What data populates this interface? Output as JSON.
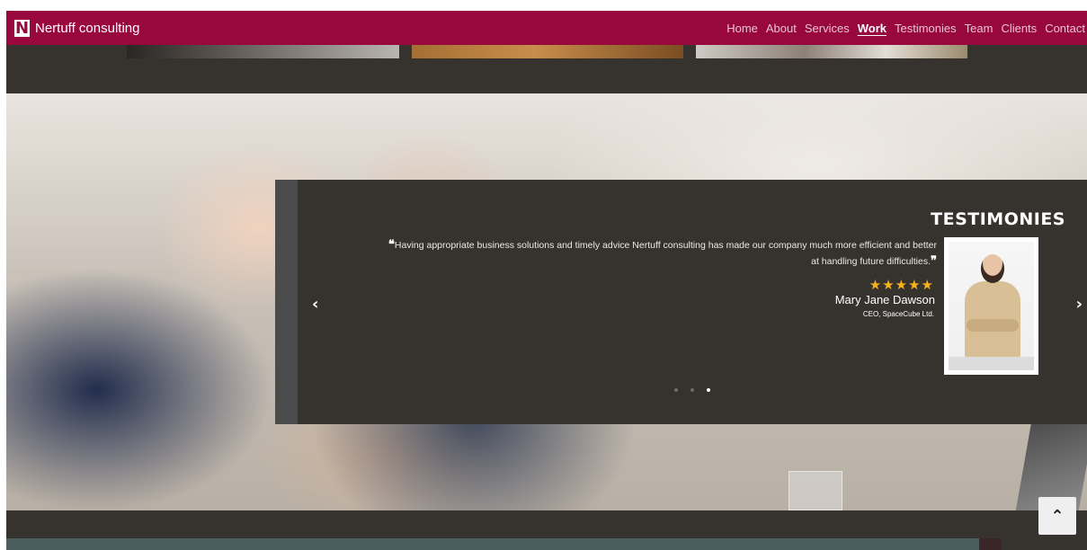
{
  "brand": {
    "logo_letter": "N",
    "name": "Nertuff consulting"
  },
  "nav": {
    "items": [
      {
        "label": "Home"
      },
      {
        "label": "About"
      },
      {
        "label": "Services"
      },
      {
        "label": "Work",
        "active": true
      },
      {
        "label": "Testimonies"
      },
      {
        "label": "Team"
      },
      {
        "label": "Clients"
      },
      {
        "label": "Contact"
      }
    ]
  },
  "testimonials": {
    "title": "TESTIMONIES",
    "quote_open": "❝",
    "quote_close": "❞",
    "quote": "Having appropriate business solutions and timely advice Nertuff consulting has made our company much more efficient and better at handling future difficulties.",
    "rating": 5,
    "stars": "★★★★★",
    "name": "Mary Jane Dawson",
    "role": "CEO, SpaceCube Ltd.",
    "prev_icon": "‹",
    "next_icon": "›",
    "slide_count": 3,
    "active_slide": 3
  },
  "back_to_top": {
    "icon": "⌃"
  },
  "colors": {
    "navbar": "#99083c",
    "panel": "#36322e",
    "star": "#f5b21c",
    "bottom_section": "#4b5d5f"
  }
}
